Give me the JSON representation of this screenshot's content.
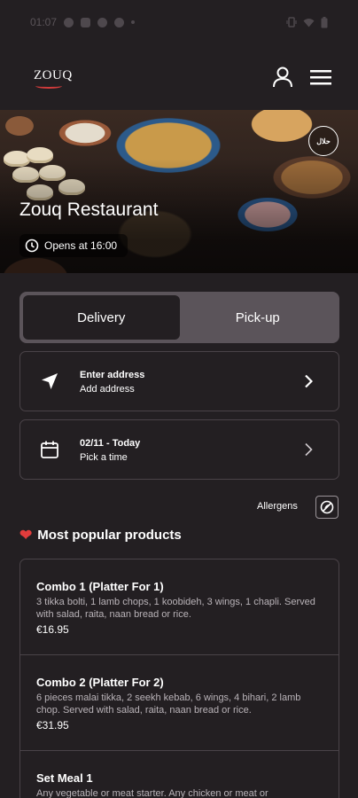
{
  "status_bar": {
    "time": "01:07"
  },
  "header": {
    "logo_text": "ZOUQ",
    "accent_color": "#d23b3b"
  },
  "hero": {
    "restaurant_name": "Zouq Restaurant",
    "opens_text": "Opens at 16:00",
    "badge_text": "حلال"
  },
  "order_mode": {
    "options": [
      "Delivery",
      "Pick-up"
    ],
    "selected": "Delivery"
  },
  "address": {
    "title": "Enter address",
    "subtitle": "Add address"
  },
  "schedule": {
    "title": "02/11 - Today",
    "subtitle": "Pick a time"
  },
  "allergens_label": "Allergens",
  "popular": {
    "title": "Most popular products",
    "items": [
      {
        "name": "Combo 1 (Platter For 1)",
        "description": "3 tikka bolti, 1 lamb chops, 1 koobideh, 3 wings, 1 chapli. Served with salad, raita, naan bread or rice.",
        "price": "€16.95"
      },
      {
        "name": "Combo 2 (Platter For 2)",
        "description": "6 pieces malai tikka, 2 seekh kebab, 6 wings, 4 bihari, 2 lamb chop. Served with salad, raita, naan bread or rice.",
        "price": "€31.95"
      },
      {
        "name": "Set Meal 1",
        "description": "Any vegetable or meat starter. Any chicken or meat or",
        "price": ""
      }
    ]
  }
}
